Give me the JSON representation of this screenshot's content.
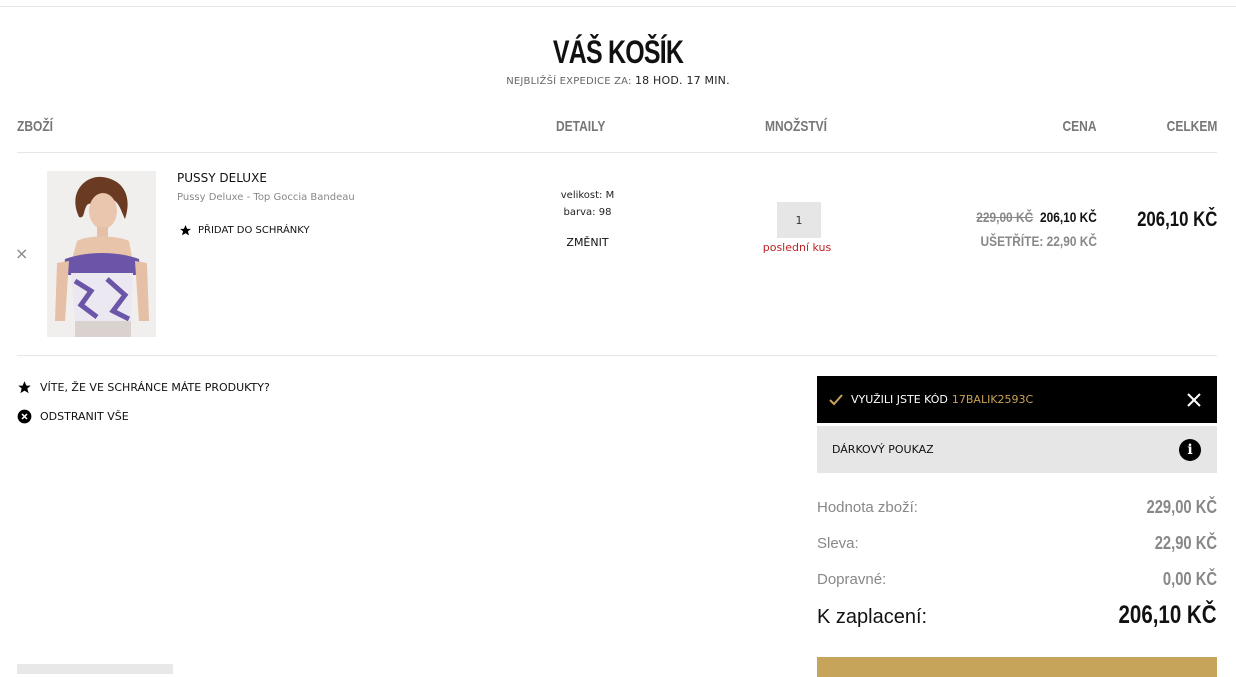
{
  "header": {
    "title": "VÁŠ KOŠÍK",
    "dispatch_label": "NEJBLIŽŠÍ EXPEDICE ZA:",
    "dispatch_time": "18 HOD. 17 MIN."
  },
  "columns": {
    "product": "ZBOŽÍ",
    "details": "DETAILY",
    "quantity": "MNOŽSTVÍ",
    "price": "CENA",
    "total": "CELKEM"
  },
  "item": {
    "remove_icon": "×",
    "name": "PUSSY DELUXE",
    "description": "Pussy Deluxe - Top Goccia Bandeau",
    "add_to_wishlist": "PŘIDAT DO SCHRÁNKY",
    "size": "velikost: M",
    "color": "barva: 98",
    "change": "ZMĚNIT",
    "quantity": "1",
    "stock_note": "poslední kus",
    "old_price": "229,00 KČ",
    "price": "206,10 KČ",
    "savings": "UŠETŘÍTE: 22,90 KČ",
    "total": "206,10 KČ"
  },
  "left_links": {
    "wishlist_notice": "VÍTE, ŽE VE SCHRÁNCE MÁTE PRODUKTY?",
    "remove_all": "ODSTRANIT VŠE"
  },
  "discount": {
    "applied_label": "VYUŽILI JSTE KÓD",
    "code": "17BALIK2593C",
    "voucher_label": "DÁRKOVÝ POUKAZ"
  },
  "summary": {
    "goods_label": "Hodnota zboží:",
    "goods_value": "229,00 KČ",
    "discount_label": "Sleva:",
    "discount_value": "22,90 KČ",
    "shipping_label": "Dopravné:",
    "shipping_value": "0,00 KČ",
    "pay_label": "K zaplacení:",
    "pay_value": "206,10 KČ"
  },
  "icons": {
    "star": "star-icon",
    "remove_circle": "remove-circle-icon",
    "check": "check-icon",
    "close": "close-icon",
    "info": "info-icon"
  },
  "colors": {
    "accent_gold": "#c6a55a",
    "stock_red": "#b22222",
    "code_bar_bg": "#000000"
  }
}
